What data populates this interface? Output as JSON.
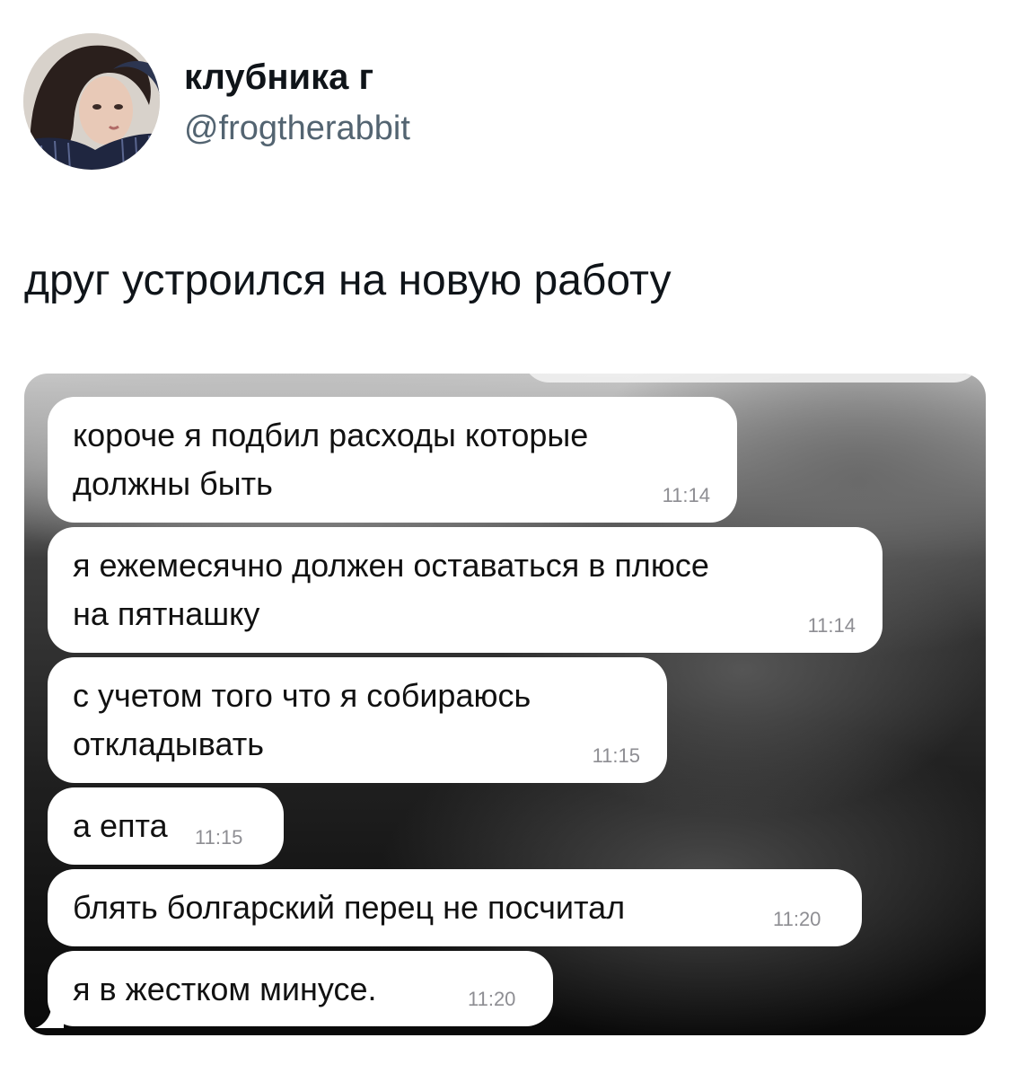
{
  "tweet": {
    "display_name": "клубника г",
    "handle": "@frogtherabbit",
    "text": "друг устроился на новую работу"
  },
  "chat": {
    "messages": [
      {
        "text": "короче я подбил расходы которые\nдолжны быть",
        "time": "11:14"
      },
      {
        "text": "я ежемесячно должен оставаться в плюсе\nна пятнашку",
        "time": "11:14"
      },
      {
        "text": "с учетом того что я собираюсь\nоткладывать",
        "time": "11:15"
      },
      {
        "text": "а епта",
        "time": "11:15"
      },
      {
        "text": "блять болгарский перец не посчитал",
        "time": "11:20"
      },
      {
        "text": "я в жестком минусе.",
        "time": "11:20"
      }
    ]
  },
  "colors": {
    "name": "#0f1419",
    "handle": "#536471",
    "bubble": "#ffffff",
    "timestamp": "#8e8e93"
  }
}
